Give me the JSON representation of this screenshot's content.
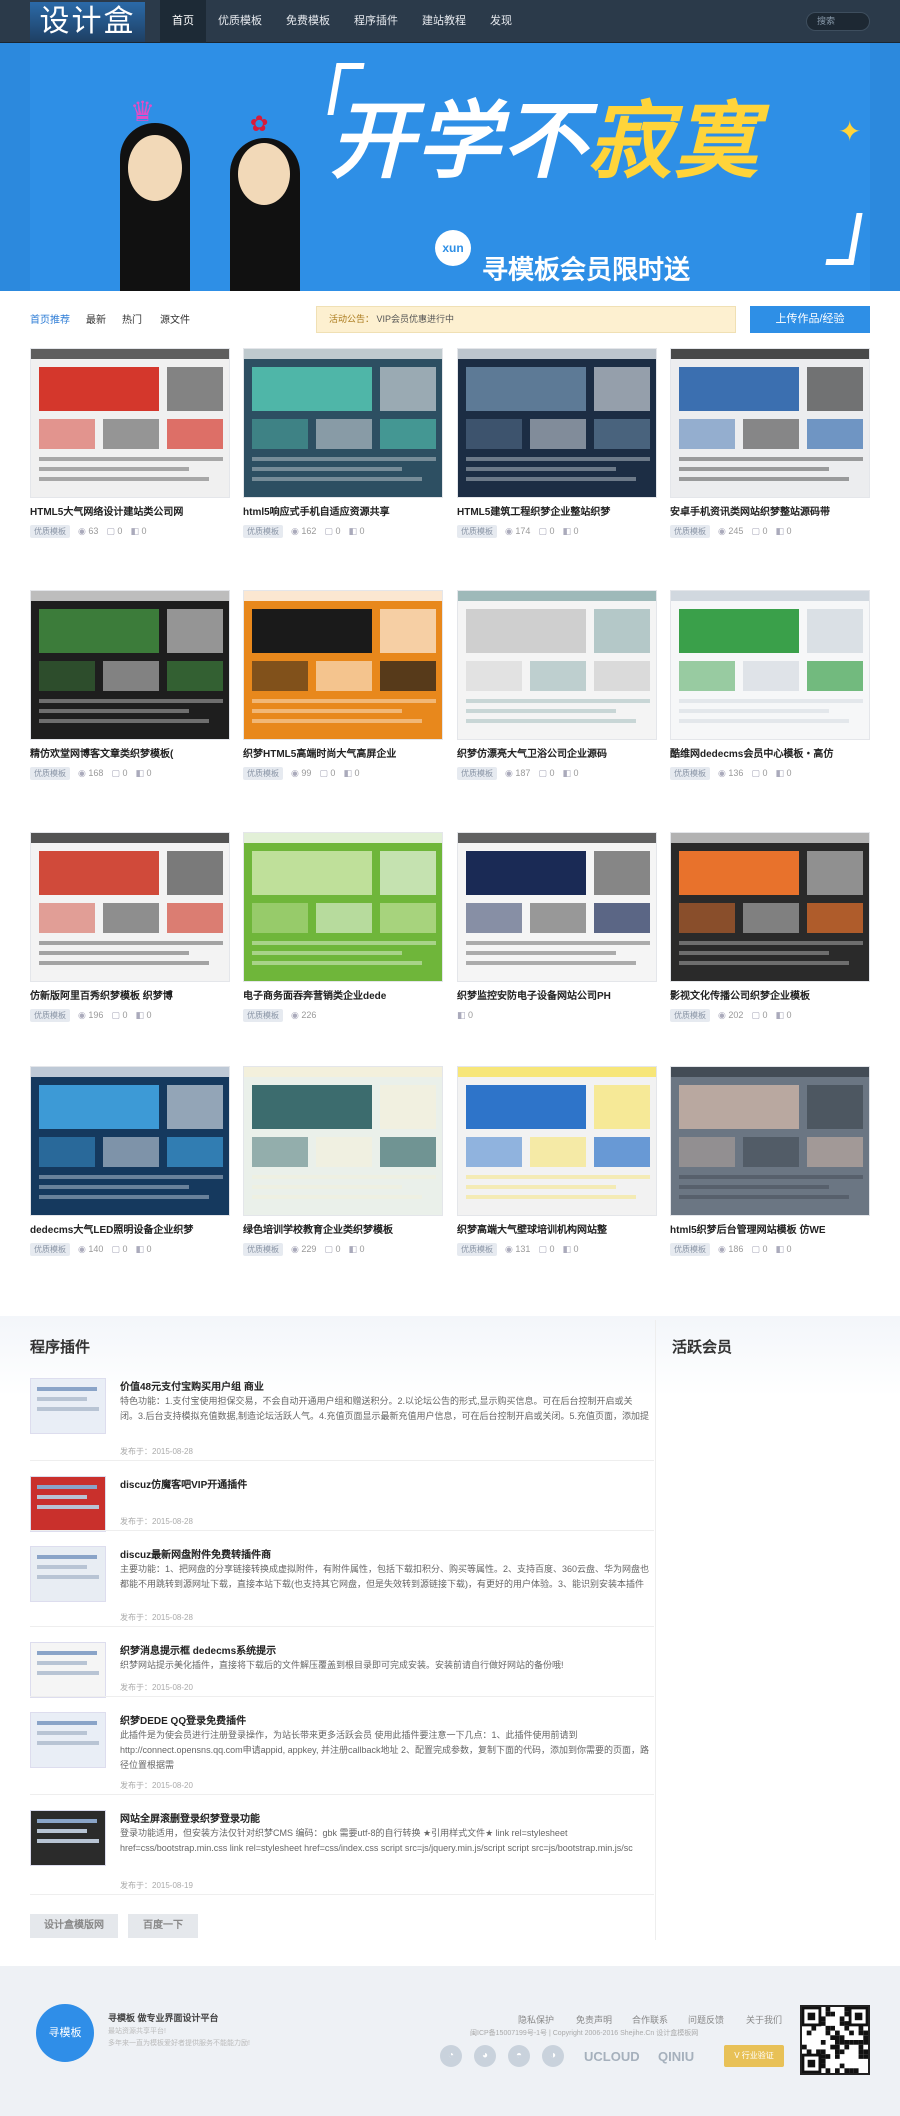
{
  "header": {
    "logo": "设计盒",
    "nav": [
      "首页",
      "优质模板",
      "免费模板",
      "程序插件",
      "建站教程",
      "发现"
    ],
    "search_placeholder": "搜索"
  },
  "banner": {
    "headline_a": "开学不",
    "headline_b": "寂寞",
    "badge": "xun",
    "subline": "寻模板会员限时送"
  },
  "filter": {
    "tabs": [
      "首页推荐",
      "最新",
      "热门",
      "源文件"
    ],
    "notice_label": "活动公告：",
    "notice_text": "VIP会员优惠进行中",
    "upload": "上传作品/经验"
  },
  "cards": [
    {
      "title": "HTML5大气网络设计建站类公司网",
      "tag": "优质模板",
      "views": "63",
      "comments": "0",
      "likes": "0"
    },
    {
      "title": "html5响应式手机自适应资源共享",
      "tag": "优质模板",
      "views": "162",
      "comments": "0",
      "likes": "0"
    },
    {
      "title": "HTML5建筑工程织梦企业整站织梦",
      "tag": "优质模板",
      "views": "174",
      "comments": "0",
      "likes": "0"
    },
    {
      "title": "安卓手机资讯类网站织梦整站源码带",
      "tag": "优质模板",
      "views": "245",
      "comments": "0",
      "likes": "0"
    },
    {
      "title": "精仿欢堂网博客文章类织梦模板(",
      "tag": "优质模板",
      "views": "168",
      "comments": "0",
      "likes": "0"
    },
    {
      "title": "织梦HTML5高端时尚大气高屏企业",
      "tag": "优质模板",
      "views": "99",
      "comments": "0",
      "likes": "0"
    },
    {
      "title": "织梦仿漂亮大气卫浴公司企业源码",
      "tag": "优质模板",
      "views": "187",
      "comments": "0",
      "likes": "0"
    },
    {
      "title": "酷维网dedecms会员中心模板・高仿",
      "tag": "优质模板",
      "views": "136",
      "comments": "0",
      "likes": "0"
    },
    {
      "title": "仿新版阿里百秀织梦模板 织梦博",
      "tag": "优质模板",
      "views": "196",
      "comments": "0",
      "likes": "0"
    },
    {
      "title": "电子商务面吞奔营销类企业dede",
      "tag": "优质模板",
      "views": "226",
      "comments": "",
      "likes": ""
    },
    {
      "title": "织梦监控安防电子设备网站公司PH",
      "tag": "",
      "views": "",
      "comments": "",
      "likes": "0"
    },
    {
      "title": "影视文化传播公司织梦企业模板",
      "tag": "优质模板",
      "views": "202",
      "comments": "0",
      "likes": "0"
    },
    {
      "title": "dedecms大气LED照明设备企业织梦",
      "tag": "优质模板",
      "views": "140",
      "comments": "0",
      "likes": "0"
    },
    {
      "title": "绿色培训学校教育企业类织梦模板",
      "tag": "优质模板",
      "views": "229",
      "comments": "0",
      "likes": "0"
    },
    {
      "title": "织梦高端大气壁球培训机构网站整",
      "tag": "优质模板",
      "views": "131",
      "comments": "0",
      "likes": "0"
    },
    {
      "title": "html5织梦后台管理网站模板 仿WE",
      "tag": "优质模板",
      "views": "186",
      "comments": "0",
      "likes": "0"
    }
  ],
  "plugins_section": {
    "title": "程序插件",
    "side_title": "活跃会员",
    "items": [
      {
        "title": "价值48元支付宝购买用户组 商业",
        "desc": "特色功能：1.支付宝使用担保交易，不会自动开通用户组和赠送积分。2.以论坛公告的形式,显示购买信息。可在后台控制开启或关闭。3.后台支持模拟充值数据,制造论坛活跃人气。4.充值页面显示最新充值用户信息，可在后台控制开启或关闭。5.充值页面，添加提",
        "date": "发布于：2015-08-28"
      },
      {
        "title": "discuz仿魔客吧VIP开通插件",
        "desc": "",
        "date": "发布于：2015-08-28"
      },
      {
        "title": "discuz最新网盘附件免费转插件商",
        "desc": "主要功能：1、把网盘的分享链接转换成虚拟附件，有附件属性，包括下载扣积分、购买等属性。2、支持百度、360云盘、华为网盘也都能不用跳转到源网址下载，直接本站下载(也支持其它网盘，但是失效转到源链接下载)，有更好的用户体验。3、能识别安装本插件",
        "date": "发布于：2015-08-28"
      },
      {
        "title": "织梦消息提示框 dedecms系统提示",
        "desc": "织梦网站提示美化插件，直接将下载后的文件解压覆盖到根目录即可完成安装。安装前请自行做好网站的备份哦!",
        "date": "发布于：2015-08-20"
      },
      {
        "title": "织梦DEDE QQ登录免费插件",
        "desc": "此插件是为使会员进行注册登录操作，为站长带来更多活跃会员 使用此插件要注意一下几点：1、此插件使用前请到http://connect.opensns.qq.com申请appid, appkey, 并注册callback地址 2、配置完成参数，复制下面的代码，添加到你需要的页面，路径位置根据需",
        "date": "发布于：2015-08-20"
      },
      {
        "title": "网站全屏滚删登录织梦登录功能",
        "desc": "登录功能适用，但安装方法仅针对织梦CMS 编码：gbk 需要utf-8的自行转换 ★引用样式文件★ link rel=stylesheet href=css/bootstrap.min.css link rel=stylesheet href=css/index.css script src=js/jquery.min.js/script script src=js/bootstrap.min.js/sc",
        "date": "发布于：2015-08-19"
      }
    ],
    "buttons": [
      "设计盒模版网",
      "百度一下"
    ]
  },
  "footer": {
    "logo": "寻模板",
    "slogan": "寻模板  做专业界面设计平台",
    "line1": "最站资源共享平台!",
    "line2": "多年来一直为模板爱好者提供服务不能能力励!",
    "links": [
      "隐私保护",
      "免责声明",
      "合作联系",
      "问题反馈",
      "关于我们"
    ],
    "copyright": "闽ICP备15007199号-1号 | Copyright 2006-2016 Shejihe.Cn 设计盒模板网",
    "brands": [
      "UCLOUD",
      "QINIU"
    ],
    "badge": "V 行业验证"
  }
}
